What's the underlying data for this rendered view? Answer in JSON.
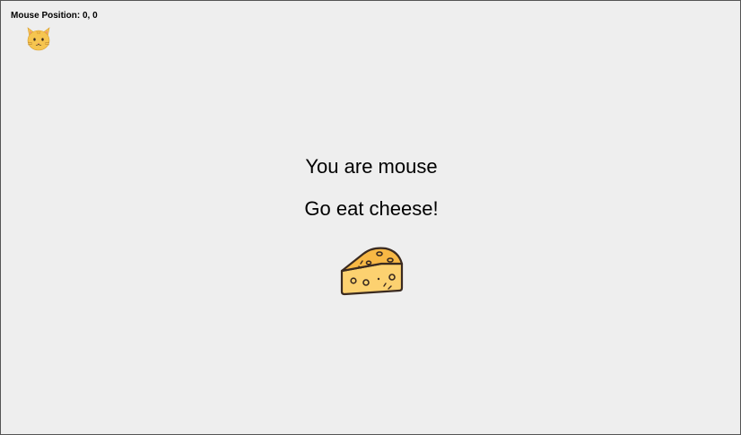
{
  "hud": {
    "mouse_position_label": "Mouse Position: 0, 0"
  },
  "game": {
    "message_line_1": "You are mouse",
    "message_line_2": "Go eat cheese!",
    "cat_icon": "cat-face-emoji",
    "cheese_icon": "cheese-wedge"
  },
  "colors": {
    "background": "#eeeeee",
    "cheese_fill": "#fcd170",
    "cheese_top": "#f7b845",
    "outline": "#3a2a20",
    "cat_fill": "#f6c550"
  }
}
